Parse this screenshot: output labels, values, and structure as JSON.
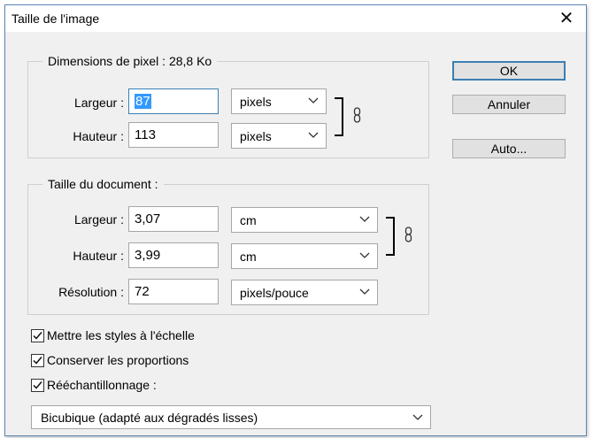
{
  "window": {
    "title": "Taille de l'image",
    "close_glyph": "✕"
  },
  "pixel_dimensions": {
    "legend": "Dimensions de pixel :  28,8 Ko",
    "width": {
      "label": "Largeur :",
      "value": "87",
      "unit": "pixels"
    },
    "height": {
      "label": "Hauteur :",
      "value": "113",
      "unit": "pixels"
    },
    "link_icon": "chain-link-icon"
  },
  "document_size": {
    "legend": "Taille du document :",
    "width": {
      "label": "Largeur :",
      "value": "3,07",
      "unit": "cm"
    },
    "height": {
      "label": "Hauteur :",
      "value": "3,99",
      "unit": "cm"
    },
    "resolution": {
      "label": "Résolution :",
      "value": "72",
      "unit": "pixels/pouce"
    },
    "link_icon": "chain-link-icon"
  },
  "buttons": {
    "ok": "OK",
    "cancel": "Annuler",
    "auto": "Auto..."
  },
  "options": {
    "scale_styles": {
      "label": "Mettre les styles à l'échelle",
      "checked": true
    },
    "constrain": {
      "label": "Conserver les proportions",
      "checked": true
    },
    "resample": {
      "label": "Rééchantillonnage :",
      "checked": true
    }
  },
  "resample_method": "Bicubique (adapté aux dégradés lisses)",
  "colors": {
    "accent": "#3c7fb1",
    "selection": "#3399ff",
    "dialog_bg": "#f0f0f0"
  }
}
